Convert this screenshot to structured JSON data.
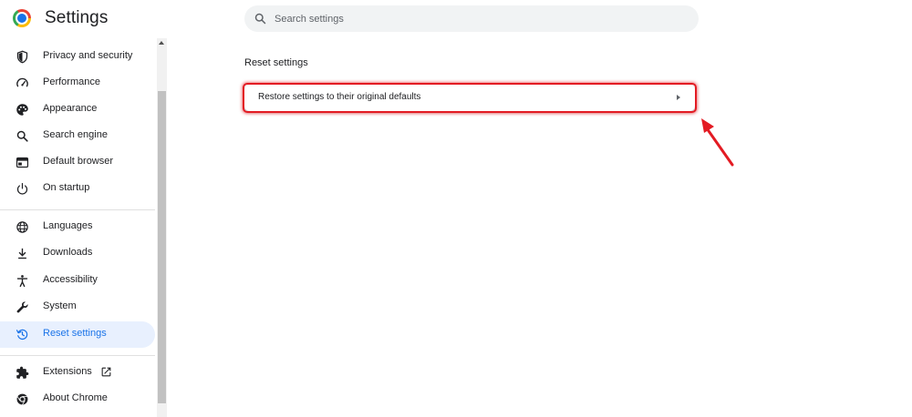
{
  "header": {
    "title": "Settings",
    "search_placeholder": "Search settings"
  },
  "sidebar": {
    "items": [
      {
        "label": "Privacy and security",
        "icon": "shield-icon"
      },
      {
        "label": "Performance",
        "icon": "speedometer-icon"
      },
      {
        "label": "Appearance",
        "icon": "palette-icon"
      },
      {
        "label": "Search engine",
        "icon": "search-icon"
      },
      {
        "label": "Default browser",
        "icon": "browser-window-icon"
      },
      {
        "label": "On startup",
        "icon": "power-icon"
      },
      {
        "label": "Languages",
        "icon": "globe-icon"
      },
      {
        "label": "Downloads",
        "icon": "download-icon"
      },
      {
        "label": "Accessibility",
        "icon": "accessibility-icon"
      },
      {
        "label": "System",
        "icon": "wrench-icon"
      },
      {
        "label": "Reset settings",
        "icon": "reset-history-icon",
        "active": true
      },
      {
        "label": "Extensions",
        "icon": "puzzle-icon"
      },
      {
        "label": "About Chrome",
        "icon": "chrome-icon"
      }
    ]
  },
  "main": {
    "section_title": "Reset settings",
    "rows": [
      {
        "label": "Restore settings to their original defaults"
      }
    ]
  },
  "colors": {
    "accent": "#1a73e8",
    "active_bg": "#e8f0fe",
    "annotation_red": "#e31b23",
    "icon_gray": "#202124"
  }
}
